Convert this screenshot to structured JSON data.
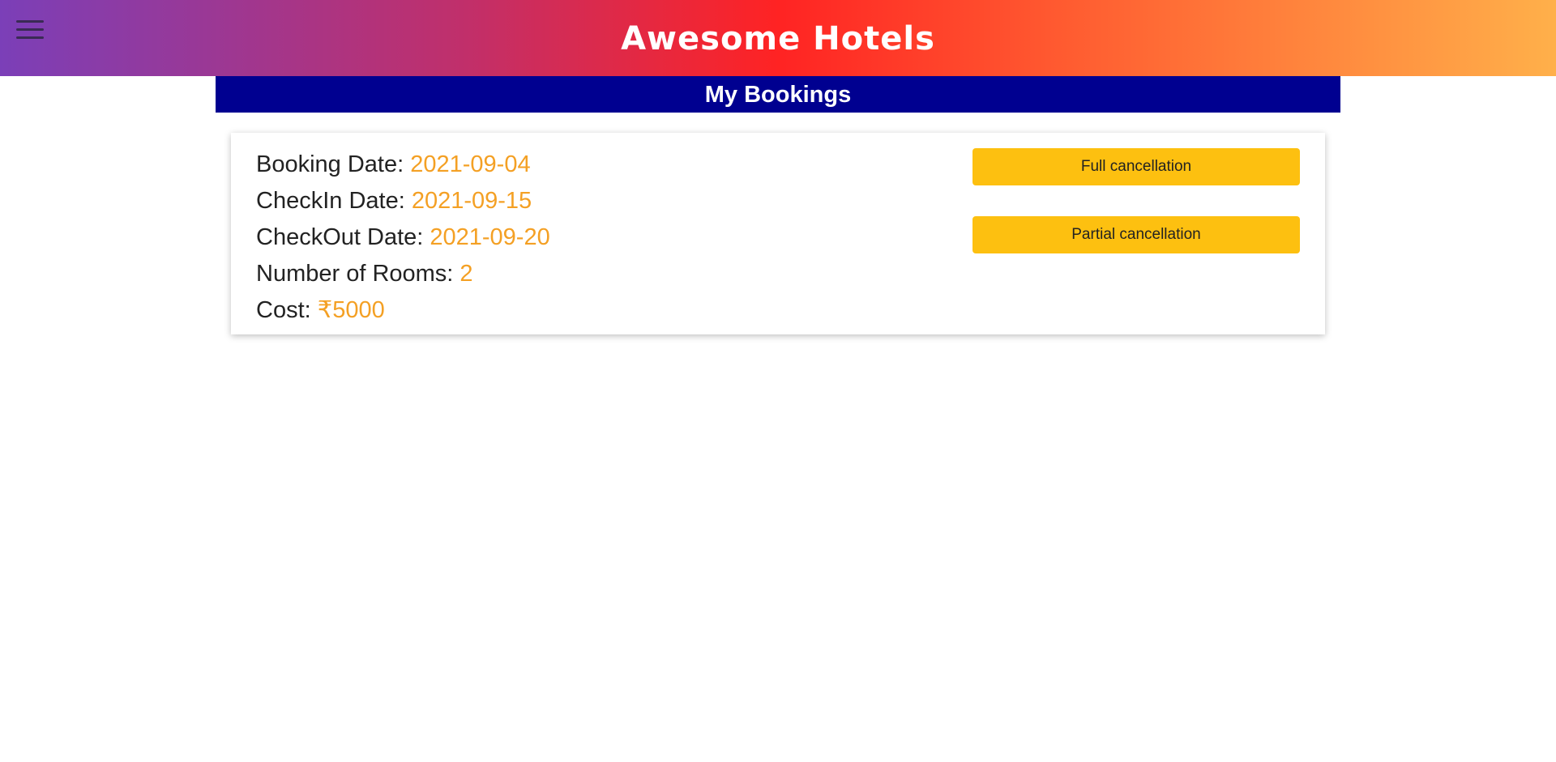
{
  "header": {
    "title": "Awesome Hotels",
    "menu_icon": "hamburger-menu-icon"
  },
  "page": {
    "title": "My Bookings"
  },
  "booking": {
    "fields": [
      {
        "label": "Booking Date: ",
        "value": "2021-09-04"
      },
      {
        "label": "CheckIn Date: ",
        "value": "2021-09-15"
      },
      {
        "label": "CheckOut Date: ",
        "value": "2021-09-20"
      },
      {
        "label": "Number of Rooms: ",
        "value": "2"
      },
      {
        "label": "Cost: ",
        "value": "₹5000"
      }
    ],
    "actions": {
      "full_label": "Full cancellation",
      "partial_label": "Partial cancellation"
    }
  },
  "colors": {
    "header_gradient_start": "#7b3fb8",
    "header_gradient_mid": "#ff2323",
    "header_gradient_end": "#ffb04a",
    "section_header": "#000090",
    "value_text": "#f4a024",
    "button": "#fdc010"
  }
}
